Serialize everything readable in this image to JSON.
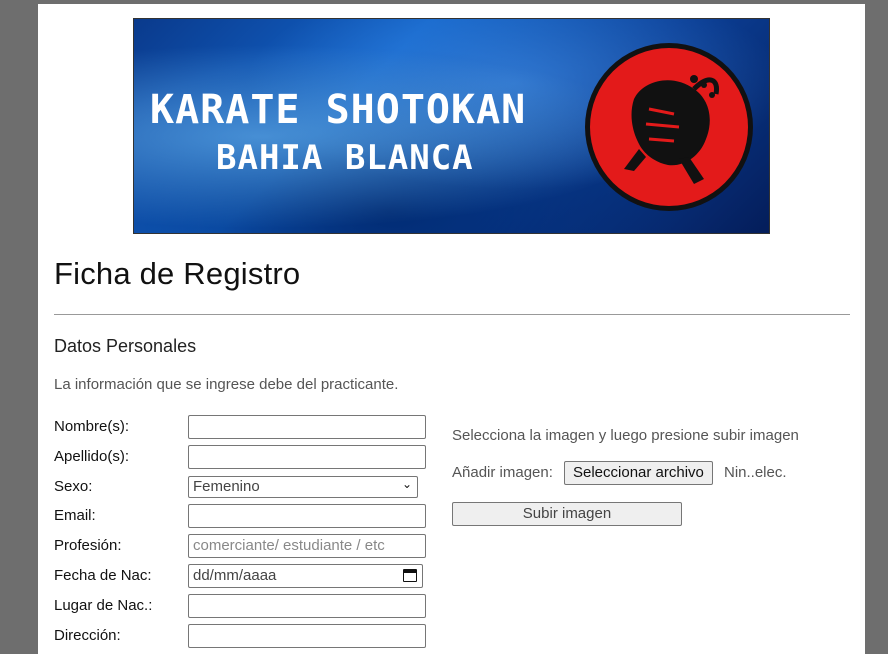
{
  "banner": {
    "line1": "KARATE SHOTOKAN",
    "line2": "BAHIA BLANCA"
  },
  "page": {
    "title": "Ficha de Registro",
    "section": "Datos Personales",
    "notice": "La información que se ingrese debe del practicante."
  },
  "form": {
    "nombre_label": "Nombre(s):",
    "apellido_label": "Apellido(s):",
    "sexo_label": "Sexo:",
    "sexo_value": "Femenino",
    "email_label": "Email:",
    "profesion_label": "Profesión:",
    "profesion_placeholder": "comerciante/ estudiante / etc",
    "fecha_label": "Fecha de Nac:",
    "fecha_placeholder": "dd/mm/aaaa",
    "lugar_label": "Lugar de Nac.:",
    "direccion_label": "Dirección:"
  },
  "upload": {
    "hint": "Selecciona la imagen y luego presione subir imagen",
    "add_label": "Añadir imagen:",
    "file_button": "Seleccionar archivo",
    "file_status": "Nin..elec.",
    "submit_button": "Subir imagen"
  },
  "colors": {
    "banner_blue": "#1263c8",
    "emblem_red": "#e31a1a"
  }
}
